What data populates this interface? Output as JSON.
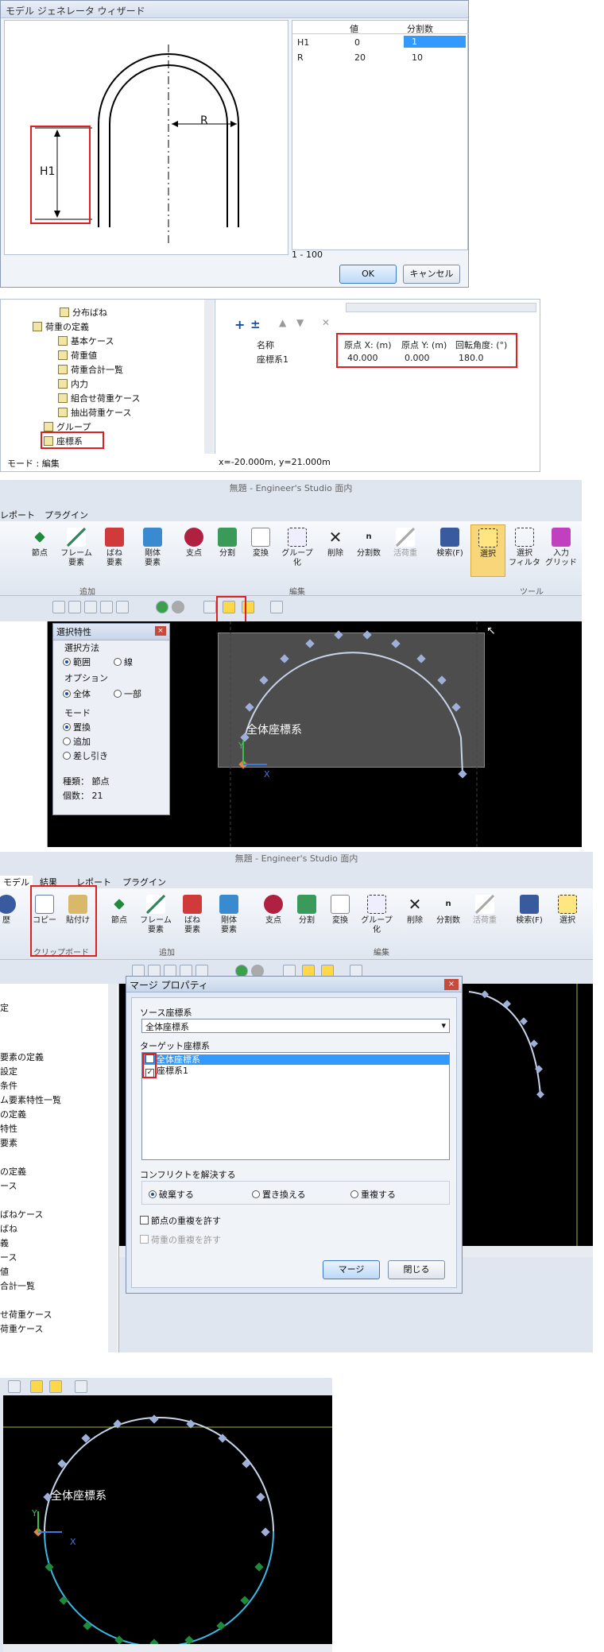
{
  "wizard": {
    "title": "モデル ジェネレータ ウィザード",
    "dim_r": "R",
    "dim_h1": "H1",
    "table_headers": [
      "",
      "値",
      "分割数"
    ],
    "rows": [
      {
        "name": "H1",
        "value": "0",
        "div": "1"
      },
      {
        "name": "R",
        "value": "20",
        "div": "10"
      }
    ],
    "range_text": "1 - 100",
    "ok_label": "OK",
    "cancel_label": "キャンセル"
  },
  "coord_panel": {
    "tree_items": [
      "分布ばね",
      "荷重の定義",
      "基本ケース",
      "荷重値",
      "荷重合計一覧",
      "内力",
      "組合せ荷重ケース",
      "抽出荷重ケース",
      "グループ",
      "座標系"
    ],
    "mode_label": "モード : 編集",
    "coord_readout": "x=-20.000m, y=21.000m",
    "headers": [
      "名称",
      "原点 X: (m)",
      "原点 Y: (m)",
      "回転角度: (°)"
    ],
    "row": {
      "name": "座標系1",
      "x": "40.000",
      "y": "0.000",
      "angle": "180.0"
    }
  },
  "studio1": {
    "title": "無題 - Engineer's Studio 面内",
    "tabs": [
      "レポート",
      "プラグイン"
    ],
    "add_items": [
      "節点",
      "フレーム\n要素",
      "ばね\n要素",
      "剛体\n要素"
    ],
    "edit_items": [
      "支点",
      "分割",
      "変換",
      "グループ\n化",
      "削除",
      "分割数",
      "活荷重"
    ],
    "tool_items": [
      "検索(F)",
      "選択",
      "選択\nフィルタ",
      "入力\nグリッド"
    ],
    "group_add": "追加",
    "group_edit": "編集",
    "group_tool": "ツール",
    "sel_panel": {
      "title": "選択特性",
      "method_label": "選択方法",
      "method_a": "範囲",
      "method_b": "線",
      "option_label": "オプション",
      "opt_a": "全体",
      "opt_b": "一部",
      "mode_label": "モード",
      "mode_a": "置換",
      "mode_b": "追加",
      "mode_c": "差し引き",
      "type_text": "種類： 節点",
      "count_text": "個数： 21"
    },
    "axis_label": "全体座標系",
    "axis_x": "X",
    "axis_y": "Y"
  },
  "studio2": {
    "title": "無題 - Engineer's Studio 面内",
    "tabs": [
      "モデル",
      "結果",
      "レポート",
      "プラグイン"
    ],
    "clip_items": [
      "コピー",
      "貼付け"
    ],
    "group_clip": "クリップボード",
    "hist_label": "歴",
    "add_items": [
      "節点",
      "フレーム\n要素",
      "ばね\n要素",
      "剛体\n要素"
    ],
    "edit_items": [
      "支点",
      "分割",
      "変換",
      "グループ\n化",
      "削除",
      "分割数",
      "活荷重"
    ],
    "tool_items": [
      "検索(F)",
      "選択"
    ],
    "group_add": "追加",
    "group_edit": "編集",
    "left_tree": [
      "定",
      "要素の定義",
      "設定",
      "条件",
      "ム要素特性一覧",
      "の定義",
      "特性",
      "要素",
      "の定義",
      "ース",
      "ばねケース",
      "ばね",
      "義",
      "ース",
      "値",
      "合計一覧",
      "せ荷重ケース",
      "荷重ケース"
    ],
    "merge": {
      "title": "マージ プロパティ",
      "source_label": "ソース座標系",
      "source_value": "全体座標系",
      "target_label": "ターゲット座標系",
      "target_items": [
        "全体座標系",
        "座標系1"
      ],
      "conflict_label": "コンフリクトを解決する",
      "conf_a": "破棄する",
      "conf_b": "置き換える",
      "conf_c": "重複する",
      "allow_nodes": "節点の重複を許す",
      "allow_loads": "荷重の重複を許す",
      "merge_label": "マージ",
      "close_label": "閉じる"
    }
  },
  "final_view": {
    "axis_label": "全体座標系",
    "axis_x": "X",
    "axis_y": "Y"
  }
}
